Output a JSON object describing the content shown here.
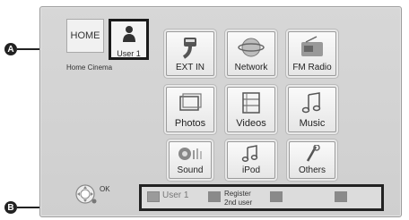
{
  "home": {
    "tab_label": "HOME",
    "subtitle": "Home Cinema"
  },
  "user": {
    "label": "User 1"
  },
  "tiles": {
    "ext_in": "EXT IN",
    "network": "Network",
    "fm_radio": "FM Radio",
    "photos": "Photos",
    "videos": "Videos",
    "music": "Music",
    "sound": "Sound",
    "ipod": "iPod",
    "others": "Others"
  },
  "remote": {
    "ok_label": "OK"
  },
  "bottom_bar": {
    "user1": "User 1",
    "register_line1": "Register",
    "register_line2": "2nd user"
  },
  "callouts": {
    "a": "A",
    "b": "B"
  },
  "colors": {
    "screen_bg": "#d3d3d3",
    "highlight_border": "#1b1b1b"
  }
}
